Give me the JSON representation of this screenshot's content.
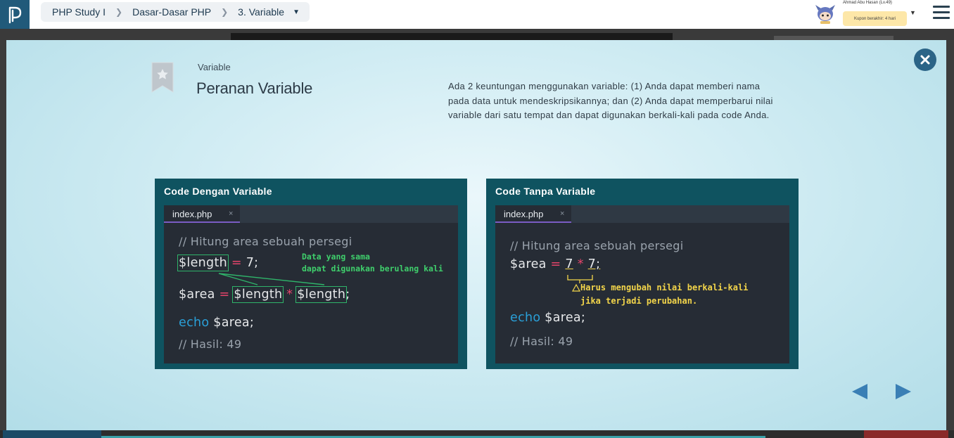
{
  "breadcrumb": {
    "course": "PHP Study I",
    "chapter": "Dasar-Dasar PHP",
    "lesson": "3. Variable"
  },
  "user": {
    "name": "Ahmad Abu Hasan (Lv.49)",
    "coupon": "Kupon berakhir: 4 hari"
  },
  "slide": {
    "eyebrow": "Variable",
    "title": "Peranan Variable",
    "description": "Ada 2 keuntungan menggunakan variable: (1) Anda dapat memberi nama pada data untuk mendeskripsikannya; dan (2) Anda dapat memperbarui nilai variable dari satu tempat dan dapat digunakan berkali-kali pada code Anda."
  },
  "left_panel": {
    "title": "Code Dengan Variable",
    "tab": "index.php",
    "tab_close": "×",
    "comment": "// Hitung area sebuah persegi",
    "var_length": "$length",
    "assign": "=",
    "value": "7;",
    "var_area": "$area",
    "times": "*",
    "semicolon": ";",
    "echo_kw": "echo",
    "echo_rest": "$area;",
    "result": "// Hasil: 49",
    "note_line1": "Data yang sama",
    "note_line2": "dapat digunakan berulang kali"
  },
  "right_panel": {
    "title": "Code Tanpa Variable",
    "tab": "index.php",
    "tab_close": "×",
    "comment": "// Hitung area sebuah persegi",
    "var_area": "$area",
    "assign": "=",
    "num1": "7",
    "times": "*",
    "num2": "7;",
    "note_line1": "Harus mengubah nilai berkali-kali",
    "note_line2": "jika terjadi perubahan.",
    "echo_kw": "echo",
    "echo_rest": "$area;",
    "result": "// Hasil: 49"
  },
  "colors": {
    "panel_bg": "#0f5360",
    "editor_bg": "#262c35",
    "keyword": "#2aa0d8",
    "operator": "#e4446a",
    "highlight_green": "#2fb46a",
    "note_yellow": "#f3d54a",
    "close_button": "#2b6487",
    "nav_arrow": "#3a7fb5"
  }
}
